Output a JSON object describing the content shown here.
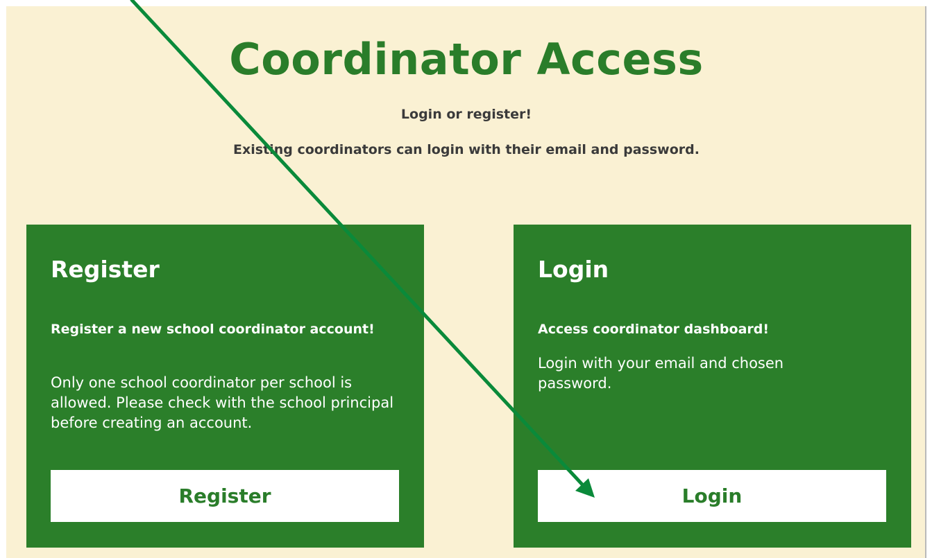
{
  "header": {
    "title": "Coordinator Access",
    "subtitle_1": "Login or register!",
    "subtitle_2": "Existing coordinators can login with their email and password."
  },
  "register_card": {
    "title": "Register",
    "lead": "Register a new school coordinator account!",
    "text": "Only one school coordinator per school is allowed. Please check with the school principal before creating an account.",
    "button_label": "Register"
  },
  "login_card": {
    "title": "Login",
    "lead": "Access coordinator dashboard!",
    "text": "Login with your email and chosen password.",
    "button_label": "Login"
  },
  "colors": {
    "background": "#faf1d3",
    "brand_green": "#2a7d2a",
    "card_green": "#2b7f2a",
    "arrow_green": "#0a8a3a"
  }
}
